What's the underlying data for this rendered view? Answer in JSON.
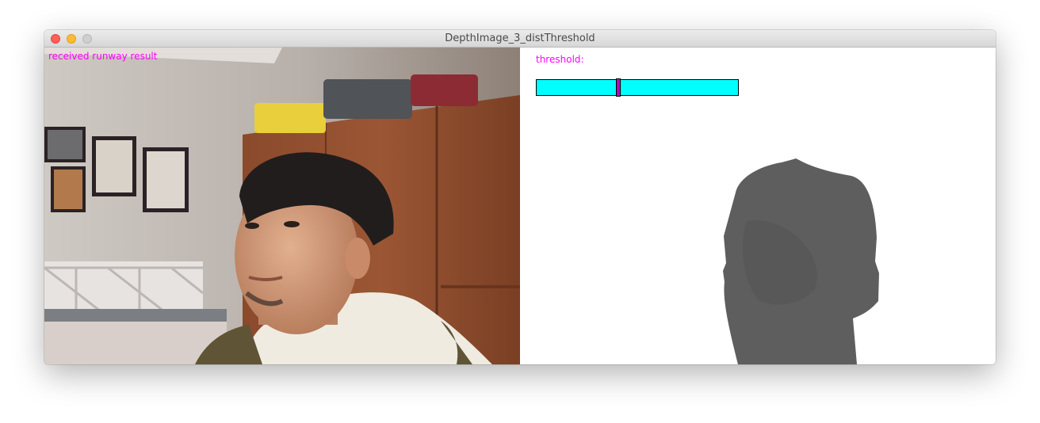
{
  "window": {
    "title": "DepthImage_3_distThreshold"
  },
  "left_panel": {
    "status_text": "received runway result",
    "status_color": "#ff00ff"
  },
  "right_panel": {
    "threshold_label": "threshold:",
    "label_color": "#ff00ff",
    "slider": {
      "value_fraction": 0.4,
      "track_color": "#00ffff",
      "handle_color": "#c000c0"
    },
    "depth_silhouette_color": "#5e5e5e"
  }
}
